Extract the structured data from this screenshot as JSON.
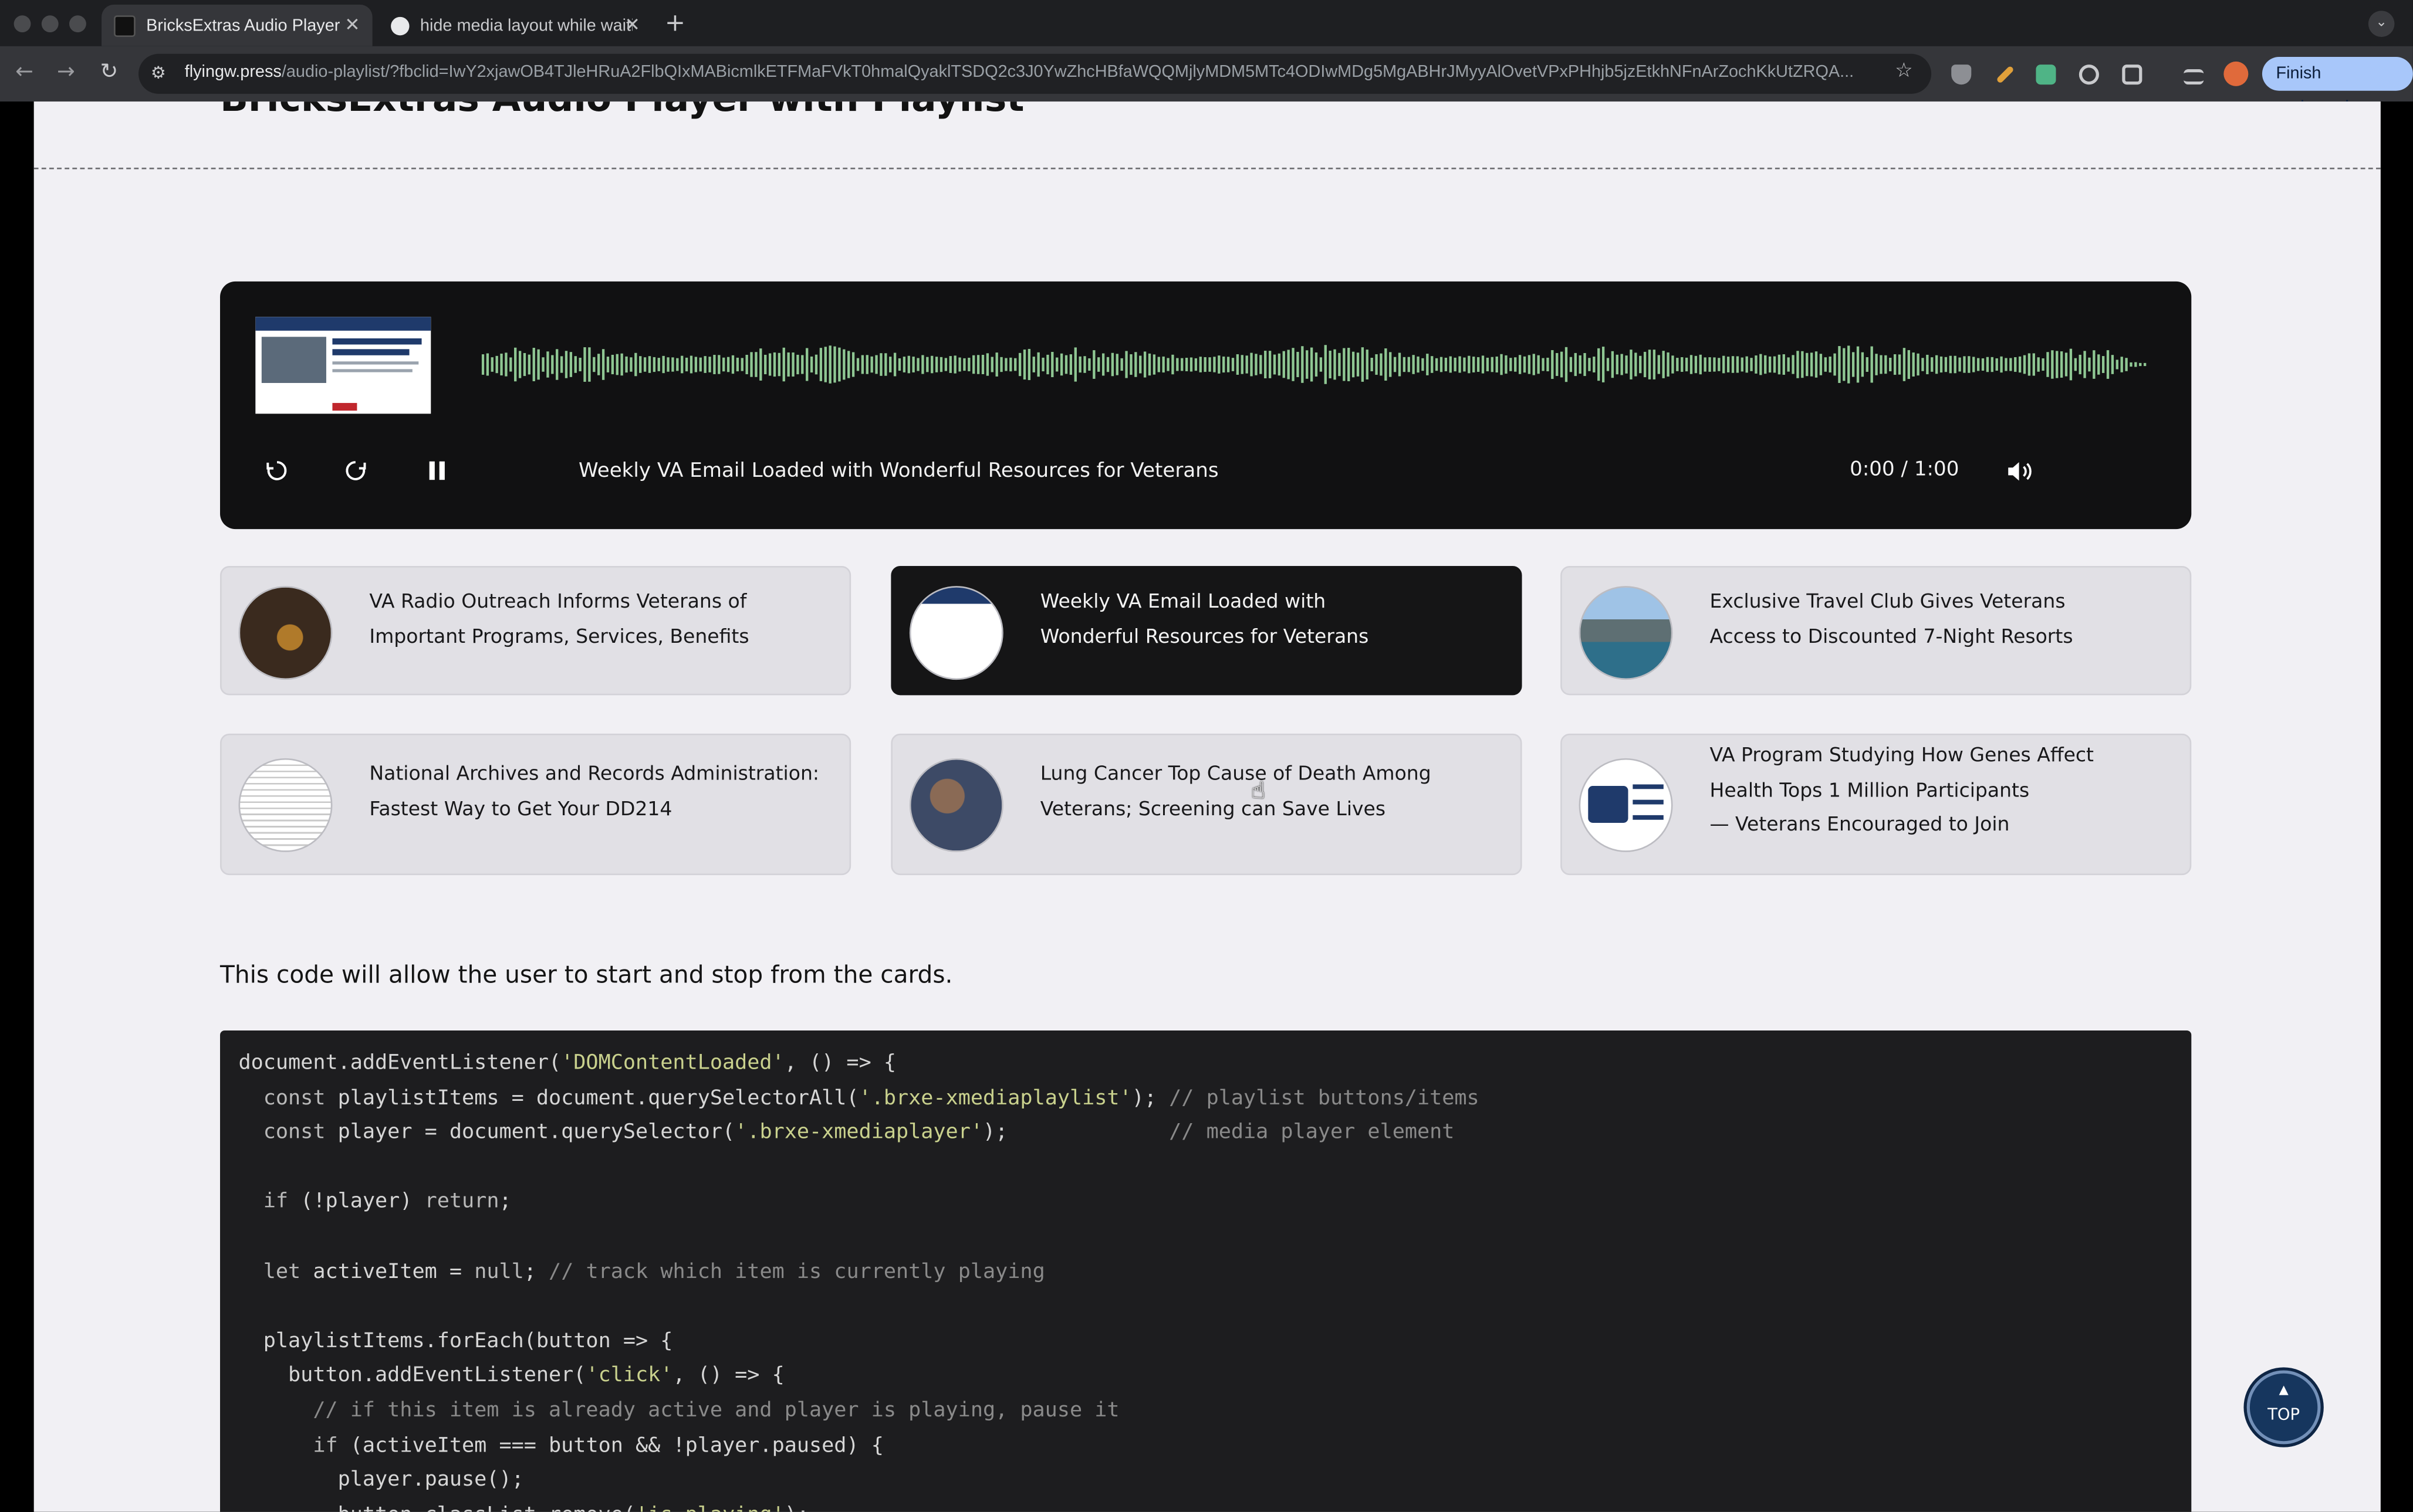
{
  "browser": {
    "tabs": [
      {
        "title": "BricksExtras Audio Player",
        "active": true,
        "close": "✕"
      },
      {
        "title": "hide media layout while waiti",
        "active": false,
        "close": "✕"
      }
    ],
    "new_tab": "+",
    "tab_menu": "⌄",
    "nav": {
      "back": "←",
      "forward": "→",
      "reload": "↻"
    },
    "url_host": "flyingw.press",
    "url_path": "/audio-playlist/?fbclid=IwY2xjawOB4TJleHRuA2FlbQIxMABicmlkETFMaFVkT0hmalQyaklTSDQ2c3J0YwZhcHBfaWQQMjlyMDM5MTc4ODIwMDg5MgABHrJMyyAlOvetVPxPHhjb5jzEtkhNFnArZochKkUtZRQA...",
    "finish_update": "Finish update",
    "finish_dots": "⋮"
  },
  "page": {
    "title": "BricksExtras Audio Player with Playlist",
    "player": {
      "now_playing": "Weekly VA Email Loaded with Wonderful Resources for Veterans",
      "time": "0:00 / 1:00",
      "colors": {
        "wave": "#8fc793",
        "background": "#111112"
      }
    },
    "playlist": [
      {
        "lines": [
          "VA Radio Outreach Informs Veterans of",
          "Important Programs, Services, Benefits"
        ],
        "active": false
      },
      {
        "lines": [
          "Weekly VA Email Loaded with",
          "Wonderful Resources for Veterans"
        ],
        "active": true
      },
      {
        "lines": [
          "Exclusive Travel Club Gives Veterans",
          "Access to Discounted 7-Night Resorts"
        ],
        "active": false
      },
      {
        "lines": [
          "National Archives and Records Administration:",
          "Fastest Way to Get Your DD214"
        ],
        "active": false
      },
      {
        "lines": [
          "Lung Cancer Top Cause of Death Among",
          "Veterans; Screening can Save Lives"
        ],
        "active": false
      },
      {
        "lines": [
          "VA Program Studying How Genes Affect",
          "Health Tops 1 Million Participants",
          "— Veterans Encouraged to Join"
        ],
        "active": false
      }
    ],
    "intro": "This code will allow the user to start and stop from the cards.",
    "code_lines": [
      [
        [
          "document.addEventListener(",
          ""
        ],
        [
          "'DOMContentLoaded'",
          "str"
        ],
        [
          ", () => {",
          ""
        ]
      ],
      [
        [
          "  const ",
          "kw"
        ],
        [
          "playlistItems = document.querySelectorAll(",
          ""
        ],
        [
          "'.brxe-xmediaplaylist'",
          "str"
        ],
        [
          "); ",
          ""
        ],
        [
          "// playlist buttons/items",
          "com"
        ]
      ],
      [
        [
          "  const ",
          "kw"
        ],
        [
          "player = document.querySelector(",
          ""
        ],
        [
          "'.brxe-xmediaplayer'",
          "str"
        ],
        [
          ");             ",
          ""
        ],
        [
          "// media player element",
          "com"
        ]
      ],
      [],
      [
        [
          "  if ",
          "kw"
        ],
        [
          "(!player) ",
          ""
        ],
        [
          "return",
          "kw"
        ],
        [
          ";",
          ""
        ]
      ],
      [],
      [
        [
          "  let ",
          "kw"
        ],
        [
          "activeItem = ",
          ""
        ],
        [
          "null",
          "kw"
        ],
        [
          "; ",
          ""
        ],
        [
          "// track which item is currently playing",
          "com"
        ]
      ],
      [],
      [
        [
          "  playlistItems.forEach(button => {",
          ""
        ]
      ],
      [
        [
          "    button.addEventListener(",
          ""
        ],
        [
          "'click'",
          "str"
        ],
        [
          ", () => {",
          ""
        ]
      ],
      [
        [
          "      // if this item is already active and player is playing, pause it",
          "com"
        ]
      ],
      [
        [
          "      if ",
          "kw"
        ],
        [
          "(activeItem === button && !player.paused) {",
          ""
        ]
      ],
      [
        [
          "        player.pause();",
          ""
        ]
      ],
      [
        [
          "        button.classList.remove(",
          ""
        ],
        [
          "'is-playing'",
          "str"
        ],
        [
          ");",
          ""
        ]
      ]
    ],
    "top_button": {
      "arrow": "▲",
      "label": "TOP"
    }
  }
}
